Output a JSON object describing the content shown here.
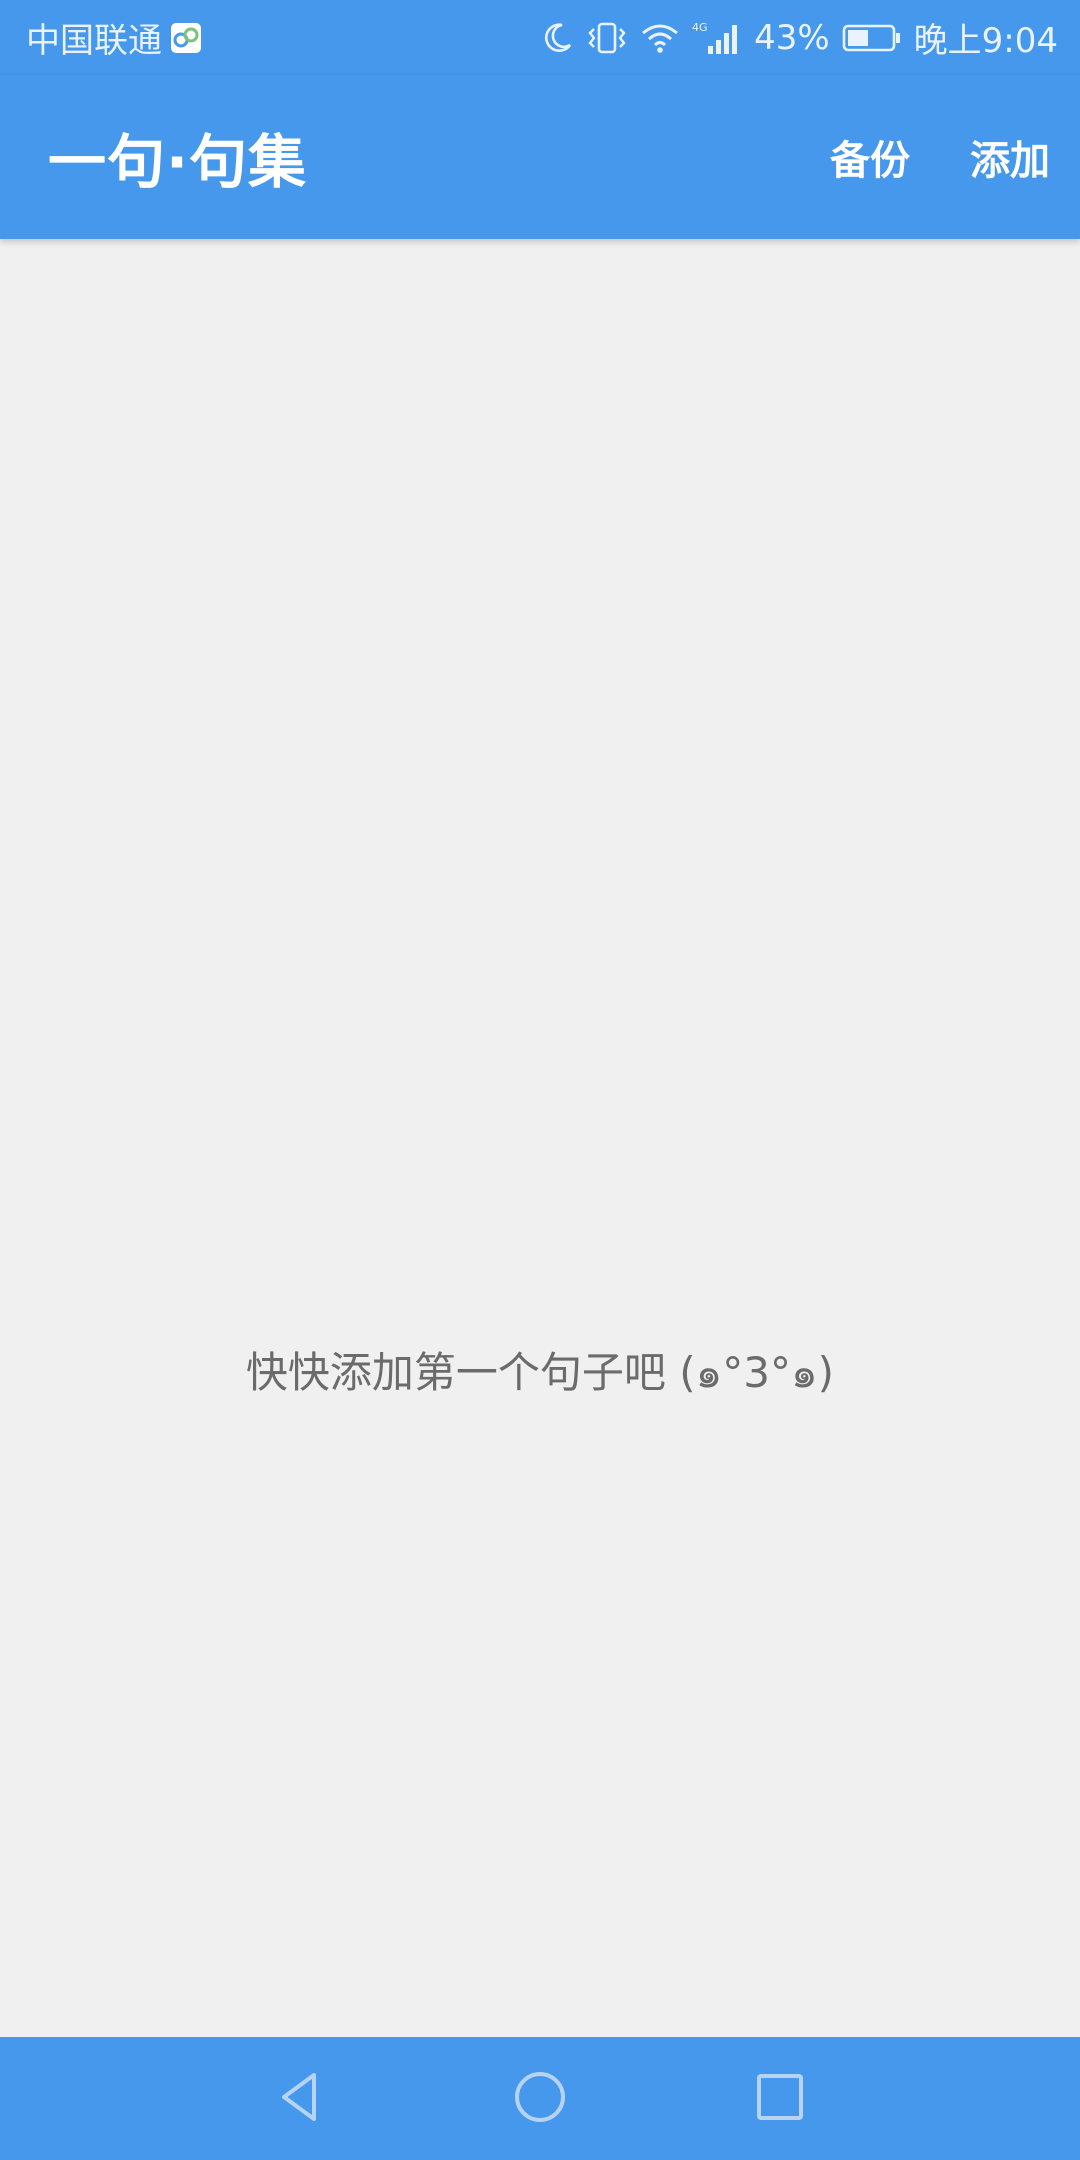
{
  "status_bar": {
    "carrier": "中国联通",
    "network": "4G",
    "battery": "43%",
    "time": "晚上9:04",
    "icons": [
      "app-notification-icon",
      "moon-icon",
      "vibrate-icon",
      "wifi-icon",
      "signal-icon",
      "battery-icon"
    ]
  },
  "app_bar": {
    "title": "一句·句集",
    "actions": {
      "backup": "备份",
      "add": "添加"
    }
  },
  "content": {
    "empty_message": "快快添加第一个句子吧 (๑°3°๑)"
  },
  "nav_bar": {
    "icons": [
      "back-icon",
      "home-icon",
      "recents-icon"
    ]
  },
  "colors": {
    "primary": "#4598ec",
    "background": "#f0f0f0",
    "message_text": "#6b6b6b",
    "nav_icon": "#b8d3f2"
  }
}
